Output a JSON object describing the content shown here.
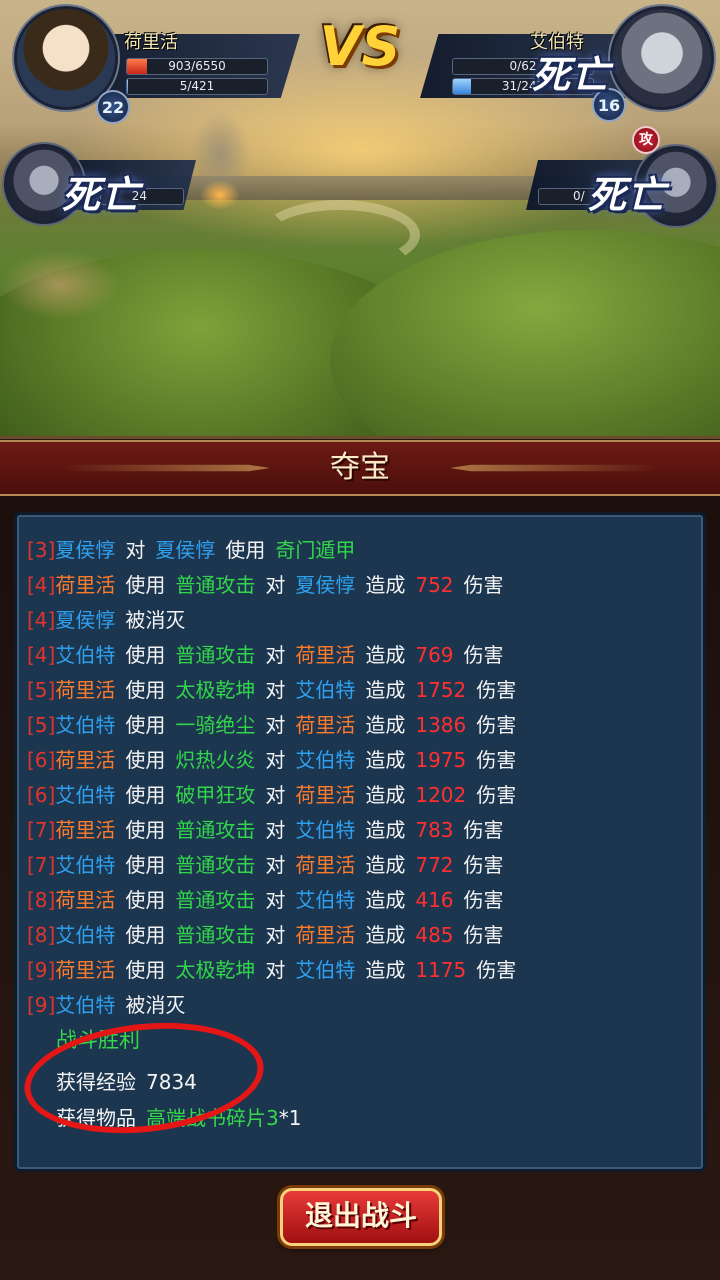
{
  "battle": {
    "vs_label": "VS",
    "player": {
      "name": "荷里活",
      "level": "22",
      "hp": "903/6550",
      "hp_ratio": 0.14,
      "mp": "5/421",
      "mp_ratio": 0.01
    },
    "enemy": {
      "name": "艾伯特",
      "level": "16",
      "hp": "0/62",
      "hp_ratio": 0,
      "mp": "31/243",
      "mp_ratio": 0.13,
      "status": "死亡"
    },
    "ally_left": {
      "status": "死亡",
      "hp_partial": "24"
    },
    "enemy_right": {
      "status": "死亡",
      "hp_partial": "0/",
      "badge": "攻"
    }
  },
  "panel": {
    "title": "夺宝",
    "log": [
      [
        [
          "c-round",
          "[3]"
        ],
        [
          "c-enemy",
          "夏侯惇"
        ],
        [
          "c-white",
          "对"
        ],
        [
          "c-enemy",
          "夏侯惇"
        ],
        [
          "c-white",
          "使用"
        ],
        [
          "c-skill",
          "奇门遁甲"
        ]
      ],
      [
        [
          "c-round",
          "[4]"
        ],
        [
          "c-hero",
          "荷里活"
        ],
        [
          "c-white",
          "使用"
        ],
        [
          "c-skill",
          "普通攻击"
        ],
        [
          "c-white",
          "对"
        ],
        [
          "c-enemy",
          "夏侯惇"
        ],
        [
          "c-white",
          "造成"
        ],
        [
          "c-dmg",
          "752"
        ],
        [
          "c-white",
          "伤害"
        ]
      ],
      [
        [
          "c-round",
          "[4]"
        ],
        [
          "c-enemy",
          "夏侯惇"
        ],
        [
          "c-white",
          "被消灭"
        ]
      ],
      [
        [
          "c-round",
          "[4]"
        ],
        [
          "c-enemy",
          "艾伯特"
        ],
        [
          "c-white",
          "使用"
        ],
        [
          "c-skill",
          "普通攻击"
        ],
        [
          "c-white",
          "对"
        ],
        [
          "c-hero",
          "荷里活"
        ],
        [
          "c-white",
          "造成"
        ],
        [
          "c-dmg",
          "769"
        ],
        [
          "c-white",
          "伤害"
        ]
      ],
      [
        [
          "c-round",
          "[5]"
        ],
        [
          "c-hero",
          "荷里活"
        ],
        [
          "c-white",
          "使用"
        ],
        [
          "c-skill",
          "太极乾坤"
        ],
        [
          "c-white",
          "对"
        ],
        [
          "c-enemy",
          "艾伯特"
        ],
        [
          "c-white",
          "造成"
        ],
        [
          "c-dmg",
          "1752"
        ],
        [
          "c-white",
          "伤害"
        ]
      ],
      [
        [
          "c-round",
          "[5]"
        ],
        [
          "c-enemy",
          "艾伯特"
        ],
        [
          "c-white",
          "使用"
        ],
        [
          "c-skill",
          "一骑绝尘"
        ],
        [
          "c-white",
          "对"
        ],
        [
          "c-hero",
          "荷里活"
        ],
        [
          "c-white",
          "造成"
        ],
        [
          "c-dmg",
          "1386"
        ],
        [
          "c-white",
          "伤害"
        ]
      ],
      [
        [
          "c-round",
          "[6]"
        ],
        [
          "c-hero",
          "荷里活"
        ],
        [
          "c-white",
          "使用"
        ],
        [
          "c-skill",
          "炽热火炎"
        ],
        [
          "c-white",
          "对"
        ],
        [
          "c-enemy",
          "艾伯特"
        ],
        [
          "c-white",
          "造成"
        ],
        [
          "c-dmg",
          "1975"
        ],
        [
          "c-white",
          "伤害"
        ]
      ],
      [
        [
          "c-round",
          "[6]"
        ],
        [
          "c-enemy",
          "艾伯特"
        ],
        [
          "c-white",
          "使用"
        ],
        [
          "c-skill",
          "破甲狂攻"
        ],
        [
          "c-white",
          "对"
        ],
        [
          "c-hero",
          "荷里活"
        ],
        [
          "c-white",
          "造成"
        ],
        [
          "c-dmg",
          "1202"
        ],
        [
          "c-white",
          "伤害"
        ]
      ],
      [
        [
          "c-round",
          "[7]"
        ],
        [
          "c-hero",
          "荷里活"
        ],
        [
          "c-white",
          "使用"
        ],
        [
          "c-skill",
          "普通攻击"
        ],
        [
          "c-white",
          "对"
        ],
        [
          "c-enemy",
          "艾伯特"
        ],
        [
          "c-white",
          "造成"
        ],
        [
          "c-dmg",
          "783"
        ],
        [
          "c-white",
          "伤害"
        ]
      ],
      [
        [
          "c-round",
          "[7]"
        ],
        [
          "c-enemy",
          "艾伯特"
        ],
        [
          "c-white",
          "使用"
        ],
        [
          "c-skill",
          "普通攻击"
        ],
        [
          "c-white",
          "对"
        ],
        [
          "c-hero",
          "荷里活"
        ],
        [
          "c-white",
          "造成"
        ],
        [
          "c-dmg",
          "772"
        ],
        [
          "c-white",
          "伤害"
        ]
      ],
      [
        [
          "c-round",
          "[8]"
        ],
        [
          "c-hero",
          "荷里活"
        ],
        [
          "c-white",
          "使用"
        ],
        [
          "c-skill",
          "普通攻击"
        ],
        [
          "c-white",
          "对"
        ],
        [
          "c-enemy",
          "艾伯特"
        ],
        [
          "c-white",
          "造成"
        ],
        [
          "c-dmg",
          "416"
        ],
        [
          "c-white",
          "伤害"
        ]
      ],
      [
        [
          "c-round",
          "[8]"
        ],
        [
          "c-enemy",
          "艾伯特"
        ],
        [
          "c-white",
          "使用"
        ],
        [
          "c-skill",
          "普通攻击"
        ],
        [
          "c-white",
          "对"
        ],
        [
          "c-hero",
          "荷里活"
        ],
        [
          "c-white",
          "造成"
        ],
        [
          "c-dmg",
          "485"
        ],
        [
          "c-white",
          "伤害"
        ]
      ],
      [
        [
          "c-round",
          "[9]"
        ],
        [
          "c-hero",
          "荷里活"
        ],
        [
          "c-white",
          "使用"
        ],
        [
          "c-skill",
          "太极乾坤"
        ],
        [
          "c-white",
          "对"
        ],
        [
          "c-enemy",
          "艾伯特"
        ],
        [
          "c-white",
          "造成"
        ],
        [
          "c-dmg",
          "1175"
        ],
        [
          "c-white",
          "伤害"
        ]
      ],
      [
        [
          "c-round",
          "[9]"
        ],
        [
          "c-enemy",
          "艾伯特"
        ],
        [
          "c-white",
          "被消灭"
        ]
      ]
    ],
    "victory": "战斗胜利",
    "exp_label": "获得经验",
    "exp_value": "7834",
    "item_label": "获得物品",
    "item_name": "高端战书碎片3",
    "item_qty": "*1"
  },
  "exit_button": "退出战斗",
  "colors": {
    "annotation": "#e51616",
    "skill": "#31d64a",
    "enemy": "#2ea0f0",
    "hero": "#ff7a2a",
    "damage": "#ff2f2f"
  }
}
